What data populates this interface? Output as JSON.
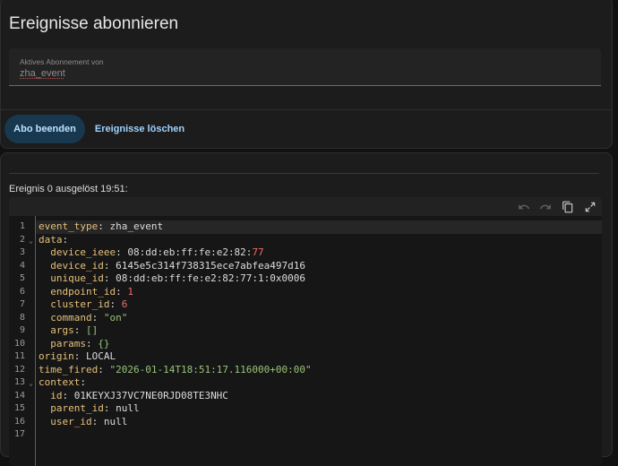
{
  "subscribe_card": {
    "title": "Ereignisse abonnieren",
    "field_label": "Aktives Abonnement von",
    "field_value": "zha_event",
    "stop_button": "Abo beenden",
    "clear_button": "Ereignisse löschen"
  },
  "event": {
    "header": "Ereignis 0 ausgelöst 19:51:"
  },
  "toolbar": {
    "icons": [
      "undo-icon",
      "redo-icon",
      "copy-icon",
      "fullscreen-icon"
    ]
  },
  "code_lines": [
    {
      "num": "1",
      "fold": "",
      "parts": [
        [
          "k",
          "event_type"
        ],
        [
          "p",
          ": zha_event"
        ]
      ]
    },
    {
      "num": "2",
      "fold": "⌄",
      "parts": [
        [
          "k",
          "data"
        ],
        [
          "p",
          ":"
        ]
      ]
    },
    {
      "num": "3",
      "fold": "",
      "parts": [
        [
          "p",
          "  "
        ],
        [
          "k",
          "device_ieee"
        ],
        [
          "p",
          ": 08:dd:eb:ff:fe:e2:82:"
        ],
        [
          "n",
          "77"
        ]
      ]
    },
    {
      "num": "4",
      "fold": "",
      "parts": [
        [
          "p",
          "  "
        ],
        [
          "k",
          "device_id"
        ],
        [
          "p",
          ": 6145e5c314f738315ece7abfea497d16"
        ]
      ]
    },
    {
      "num": "5",
      "fold": "",
      "parts": [
        [
          "p",
          "  "
        ],
        [
          "k",
          "unique_id"
        ],
        [
          "p",
          ": 08:dd:eb:ff:fe:e2:82:77:1:0x0006"
        ]
      ]
    },
    {
      "num": "6",
      "fold": "",
      "parts": [
        [
          "p",
          "  "
        ],
        [
          "k",
          "endpoint_id"
        ],
        [
          "p",
          ": "
        ],
        [
          "n",
          "1"
        ]
      ]
    },
    {
      "num": "7",
      "fold": "",
      "parts": [
        [
          "p",
          "  "
        ],
        [
          "k",
          "cluster_id"
        ],
        [
          "p",
          ": "
        ],
        [
          "n",
          "6"
        ]
      ]
    },
    {
      "num": "8",
      "fold": "",
      "parts": [
        [
          "p",
          "  "
        ],
        [
          "k",
          "command"
        ],
        [
          "p",
          ": "
        ],
        [
          "s",
          "\"on\""
        ]
      ]
    },
    {
      "num": "9",
      "fold": "",
      "parts": [
        [
          "p",
          "  "
        ],
        [
          "k",
          "args"
        ],
        [
          "p",
          ": "
        ],
        [
          "s",
          "[]"
        ]
      ]
    },
    {
      "num": "10",
      "fold": "",
      "parts": [
        [
          "p",
          "  "
        ],
        [
          "k",
          "params"
        ],
        [
          "p",
          ": "
        ],
        [
          "s",
          "{}"
        ]
      ]
    },
    {
      "num": "11",
      "fold": "",
      "parts": [
        [
          "k",
          "origin"
        ],
        [
          "p",
          ": LOCAL"
        ]
      ]
    },
    {
      "num": "12",
      "fold": "",
      "parts": [
        [
          "k",
          "time_fired"
        ],
        [
          "p",
          ": "
        ],
        [
          "s",
          "\"2026-01-14T18:51:17.116000+00:00\""
        ]
      ]
    },
    {
      "num": "13",
      "fold": "⌄",
      "parts": [
        [
          "k",
          "context"
        ],
        [
          "p",
          ":"
        ]
      ]
    },
    {
      "num": "14",
      "fold": "",
      "parts": [
        [
          "p",
          "  "
        ],
        [
          "k",
          "id"
        ],
        [
          "p",
          ": 01KEYXJ37VC7NE0RJD08TE3NHC"
        ]
      ]
    },
    {
      "num": "15",
      "fold": "",
      "parts": [
        [
          "p",
          "  "
        ],
        [
          "k",
          "parent_id"
        ],
        [
          "p",
          ": null"
        ]
      ]
    },
    {
      "num": "16",
      "fold": "",
      "parts": [
        [
          "p",
          "  "
        ],
        [
          "k",
          "user_id"
        ],
        [
          "p",
          ": null"
        ]
      ]
    },
    {
      "num": "17",
      "fold": "",
      "parts": []
    }
  ]
}
